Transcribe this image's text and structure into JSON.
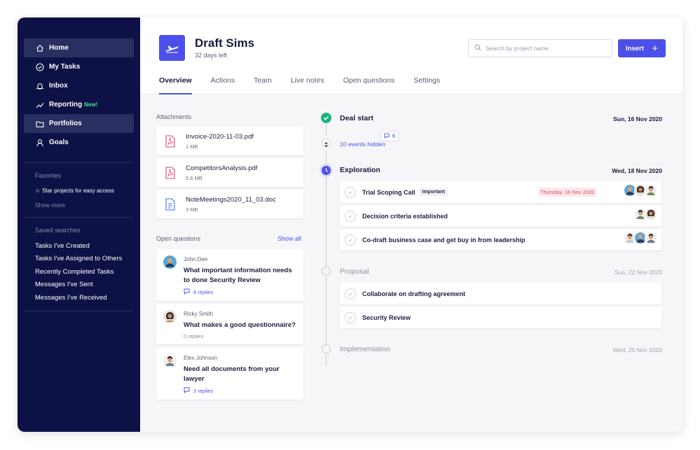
{
  "sidebar": {
    "nav": [
      {
        "label": "Home",
        "icon": "home-icon",
        "selected": true
      },
      {
        "label": "My Tasks",
        "icon": "check-circle-icon"
      },
      {
        "label": "Inbox",
        "icon": "bell-icon"
      },
      {
        "label": "Reporting",
        "icon": "trend-line-icon",
        "badge": "New!"
      },
      {
        "label": "Portfolios",
        "icon": "folder-icon",
        "selected": true
      },
      {
        "label": "Goals",
        "icon": "person-icon"
      }
    ],
    "favorites": {
      "heading": "Favorites",
      "hint": "Star projects for easy access",
      "more": "Show more"
    },
    "saved": {
      "heading": "Saved searches",
      "items": [
        "Tasks I've Created",
        "Tasks I've Assigned to Others",
        "Recently Completed Tasks",
        "Messages I've Sent",
        "Messages I've Received"
      ]
    }
  },
  "header": {
    "title": "Draft Sims",
    "subtitle": "32 days left",
    "search_placeholder": "Search by project name..",
    "insert_label": "Insert",
    "tabs": [
      "Overview",
      "Actions",
      "Team",
      "Live notes",
      "Open questions",
      "Settings"
    ]
  },
  "attachments": {
    "heading": "Attachments",
    "files": [
      {
        "name": "Invoice-2020-11-03.pdf",
        "size": "1 MB",
        "type": "pdf"
      },
      {
        "name": "CompetitorsAnalysis.pdf",
        "size": "5.6 MB",
        "type": "pdf"
      },
      {
        "name": "NoteMeetings2020_11_03.doc",
        "size": "3 MB",
        "type": "doc"
      }
    ]
  },
  "questions": {
    "heading": "Open questions",
    "show_all": "Show all",
    "items": [
      {
        "author": "John Dee",
        "text": "What important information needs to done Security Review",
        "replies": "6 replies"
      },
      {
        "author": "Ricky Smith",
        "text": "What makes a good questionnaire?",
        "replies": "0 replies"
      },
      {
        "author": "Elex Johnson",
        "text": "Need all documents from your lawyer",
        "replies": "2 replies"
      }
    ]
  },
  "timeline": {
    "deal_start": {
      "title": "Deal start",
      "count": "6",
      "date": "Sun, 16 Nov 2020",
      "hidden": "10 events hidden"
    },
    "exploration": {
      "title": "Exploration",
      "date": "Wed, 18 Nov 2020",
      "tasks": [
        {
          "name": "Trial Scoping Call",
          "badge": "Important",
          "due": "Thursday, 16 Nov 2020"
        },
        {
          "name": "Decision criteria established"
        },
        {
          "name": "Co-draft business case and get buy in from leadership"
        }
      ]
    },
    "proposal": {
      "title": "Proposal",
      "date": "Sun, 22 Nov 2020",
      "tasks": [
        {
          "name": "Collaborate on drafting agreement"
        },
        {
          "name": "Security Review"
        }
      ]
    },
    "implementation": {
      "title": "Implementation",
      "date": "Wed, 25 Nov 2020"
    }
  },
  "colors": {
    "accent": "#4d50e8",
    "sidebar": "#0d1145",
    "success": "#1db37a",
    "danger": "#e2435f"
  }
}
